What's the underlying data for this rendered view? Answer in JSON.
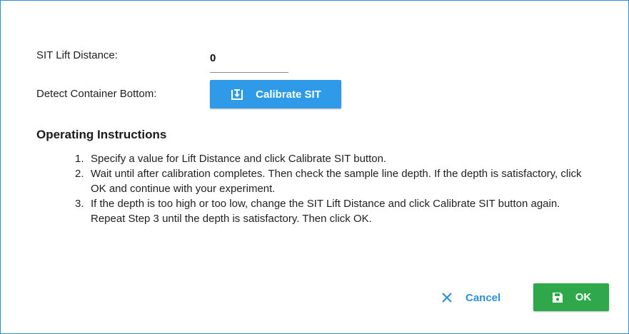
{
  "form": {
    "lift_distance_label": "SIT Lift Distance:",
    "lift_distance_value": "0",
    "detect_bottom_label": "Detect Container Bottom:",
    "calibrate_button_label": "Calibrate SIT",
    "calibrate_icon": "calibrate-sit-icon"
  },
  "instructions": {
    "title": "Operating Instructions",
    "items": [
      {
        "number": "1.",
        "text": "Specify a value for Lift Distance and click Calibrate SIT button."
      },
      {
        "number": "2.",
        "text": "Wait until after calibration completes. Then check the sample line depth. If the depth is satisfactory, click OK and continue with your experiment."
      },
      {
        "number": "3.",
        "text": "If the depth is too high or too low, change the SIT Lift Distance and click Calibrate SIT button again. Repeat Step 3 until the depth is satisfactory. Then click OK."
      }
    ]
  },
  "actions": {
    "cancel_label": "Cancel",
    "cancel_icon": "close-icon",
    "ok_label": "OK",
    "ok_icon": "save-icon"
  },
  "colors": {
    "dialog_border": "#2b8ed6",
    "calibrate_button": "#2e9ae8",
    "cancel_text": "#2e8fd8",
    "ok_button": "#2ea84a"
  }
}
